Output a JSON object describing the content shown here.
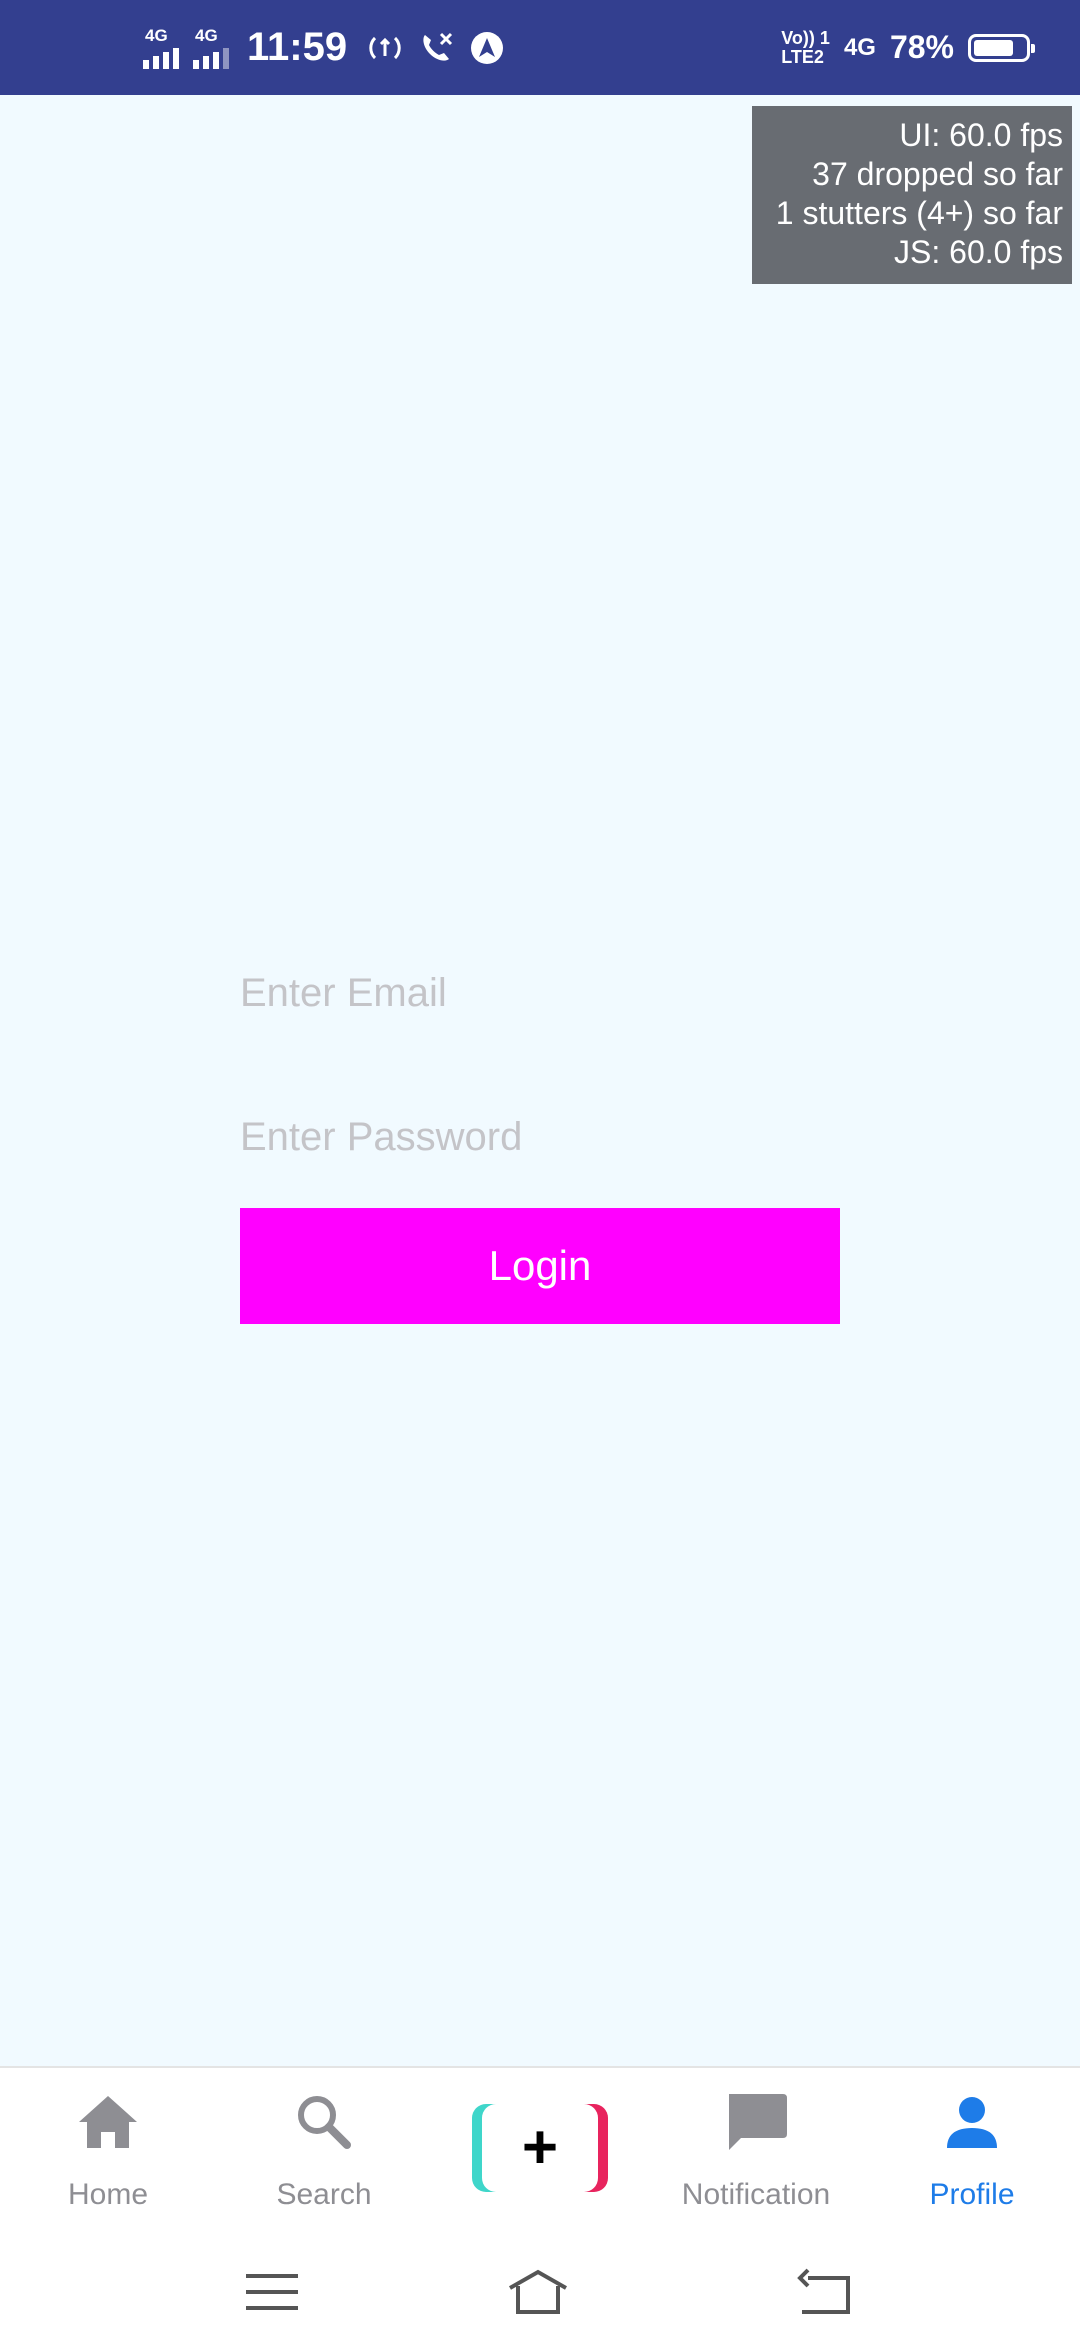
{
  "status_bar": {
    "network1": "4G",
    "network2": "4G",
    "time": "11:59",
    "volte_top": "Vo)) 1",
    "volte_bottom": "LTE2",
    "network3": "4G",
    "battery_pct": "78%",
    "battery_level": 0.78,
    "icons": [
      "signal-icon",
      "signal-icon",
      "hotspot-icon",
      "wifi-calling-icon",
      "navigation-icon",
      "battery-icon"
    ]
  },
  "perf_monitor": {
    "ui_fps": "UI: 60.0 fps",
    "dropped": "37 dropped so far",
    "stutters": "1 stutters (4+) so far",
    "js_fps": "JS: 60.0 fps"
  },
  "login_form": {
    "email_placeholder": "Enter Email",
    "email_value": "",
    "password_placeholder": "Enter Password",
    "password_value": "",
    "login_label": "Login",
    "login_color": "#FF00FF"
  },
  "tab_bar": {
    "tabs": [
      {
        "label": "Home",
        "icon": "home-icon"
      },
      {
        "label": "Search",
        "icon": "search-icon"
      },
      {
        "label": "",
        "icon": "add-icon"
      },
      {
        "label": "Notification",
        "icon": "chat-bubble-icon"
      },
      {
        "label": "Profile",
        "icon": "person-icon"
      }
    ],
    "active_tab": "Profile",
    "active_color": "#1E7CE8",
    "inactive_color": "#8E8E93"
  },
  "system_nav": {
    "buttons": [
      "menu-icon",
      "home-outline-icon",
      "back-icon"
    ]
  },
  "colors": {
    "status_bar": "#333F8F",
    "background": "#F1FAFF",
    "perf_overlay": "#686C72"
  }
}
